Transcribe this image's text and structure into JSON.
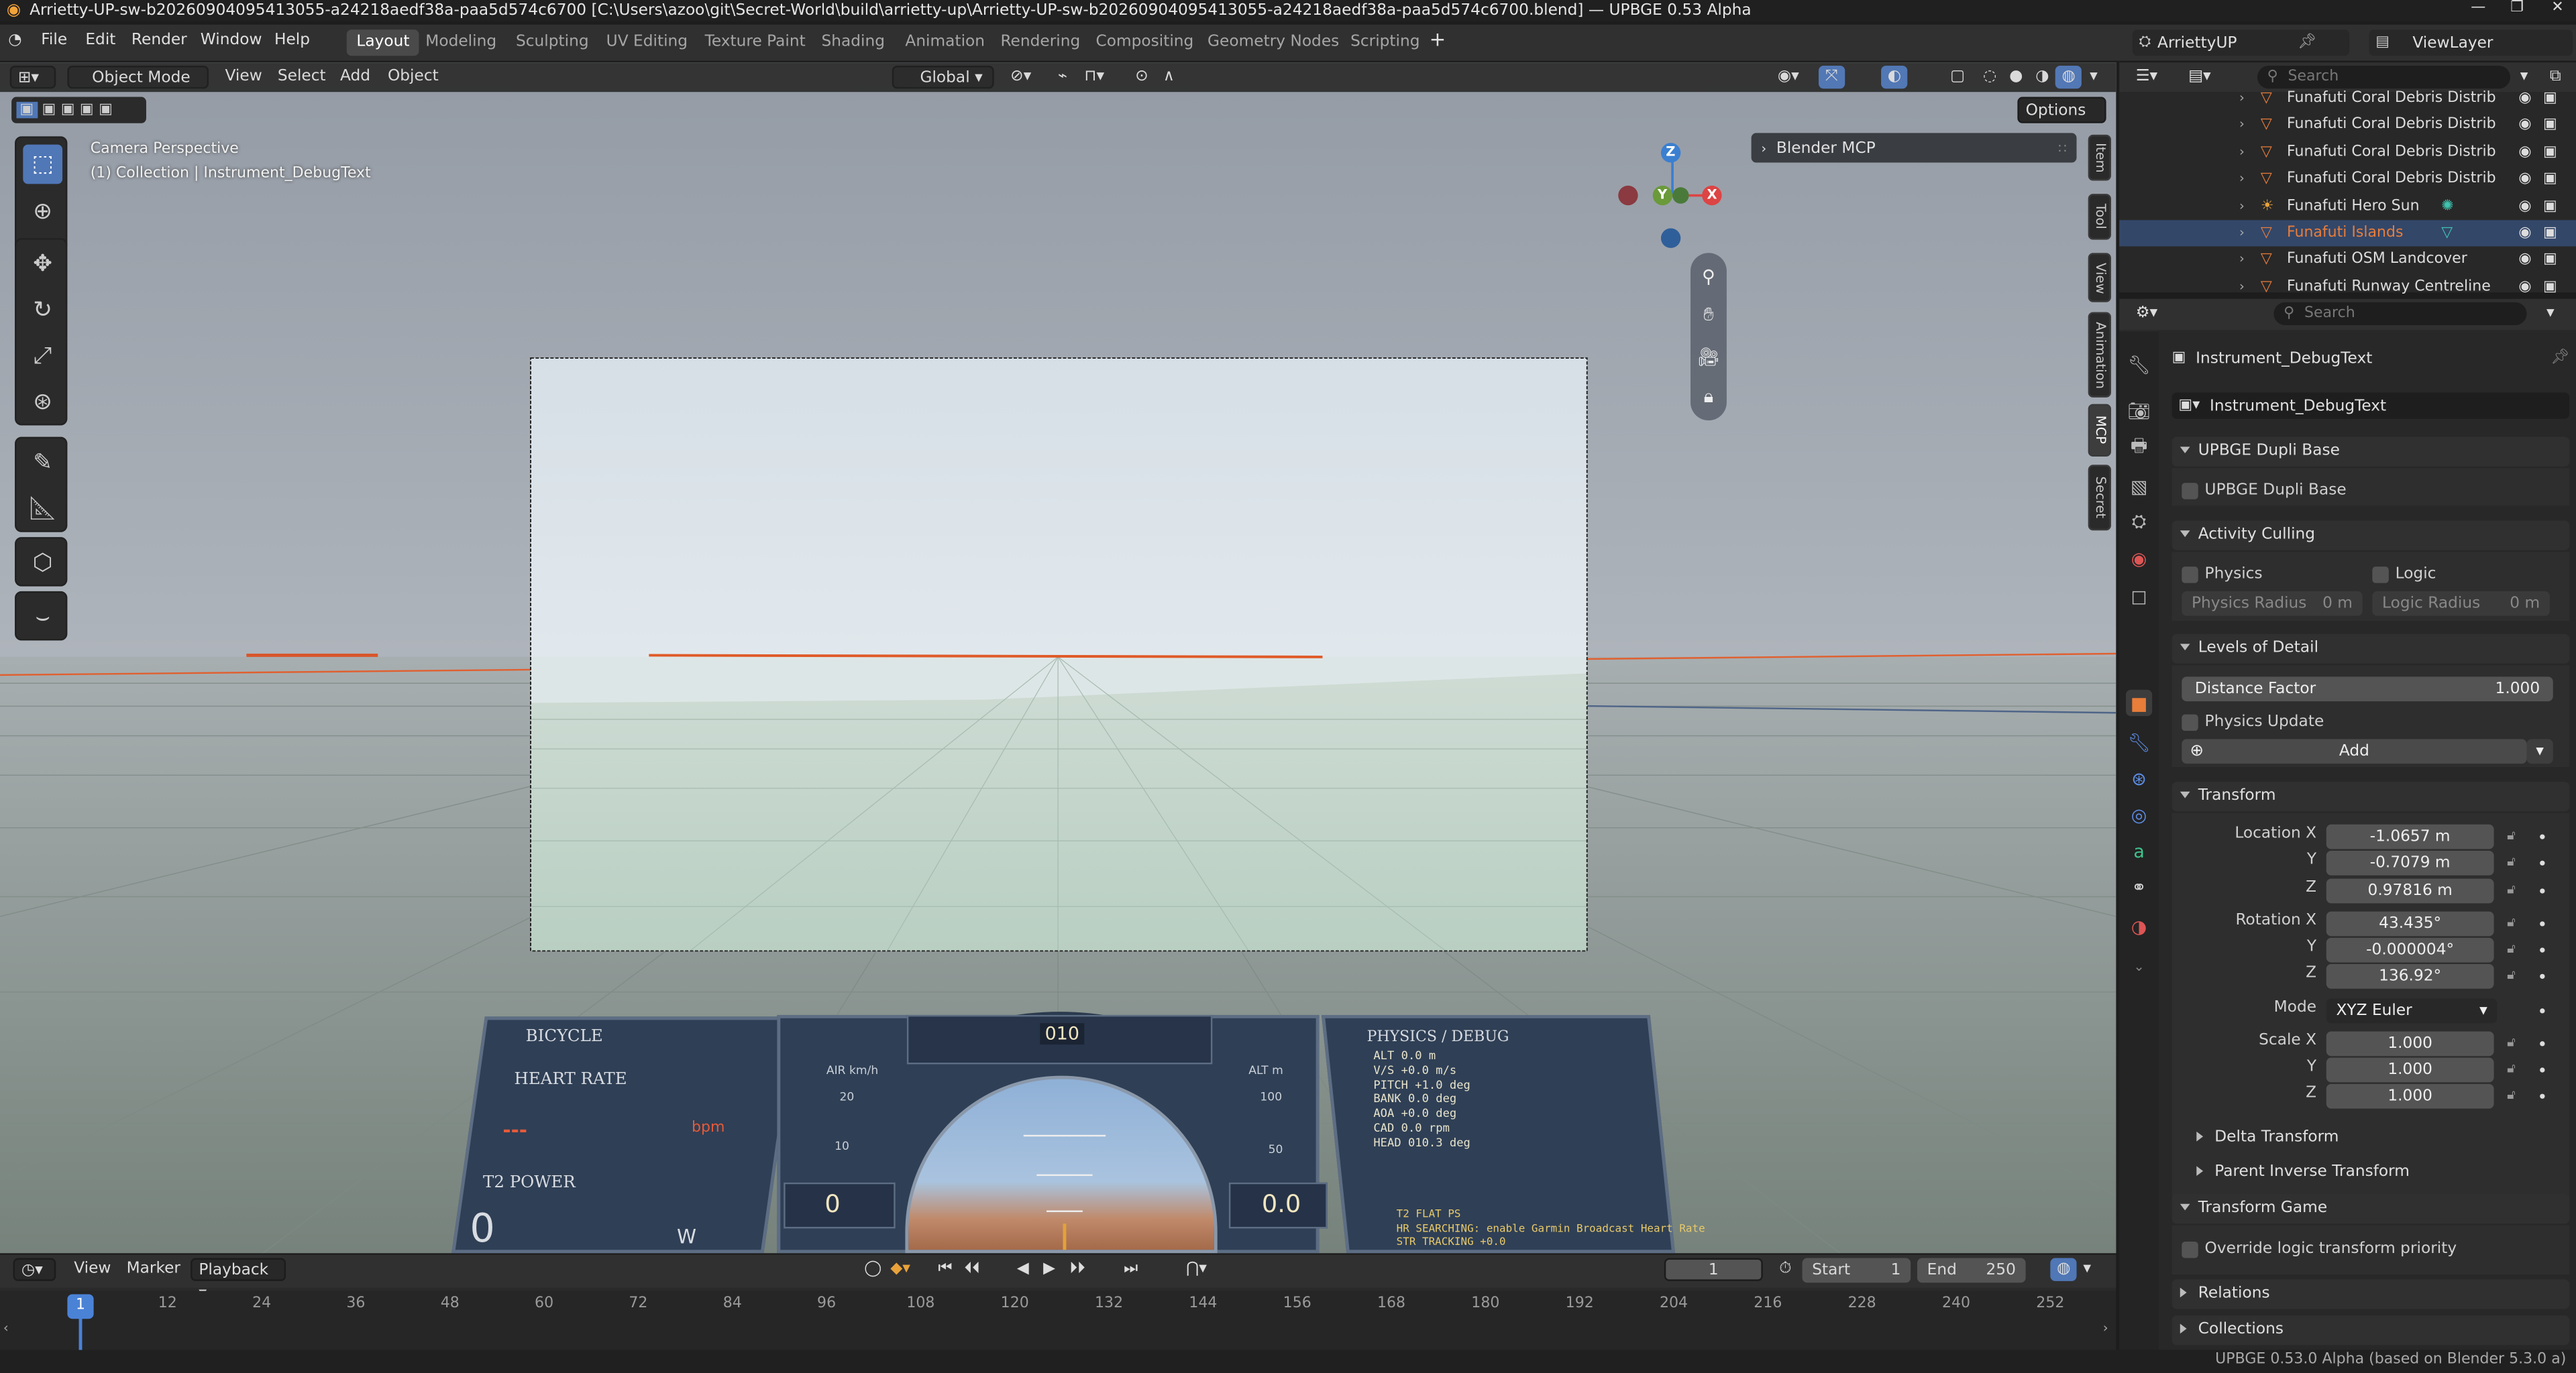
{
  "titlebar": {
    "title": "Arrietty-UP-sw-b20260904095413055-a24218aedf38a-paa5d574c6700 [C:\\Users\\azoo\\git\\Secret-World\\build\\arrietty-up\\Arrietty-UP-sw-b20260904095413055-a24218aedf38a-paa5d574c6700.blend] — UPBGE 0.53 Alpha"
  },
  "menu": {
    "file": "File",
    "edit": "Edit",
    "render": "Render",
    "window": "Window",
    "help": "Help"
  },
  "workspaces": [
    "Layout",
    "Modeling",
    "Sculpting",
    "UV Editing",
    "Texture Paint",
    "Shading",
    "Animation",
    "Rendering",
    "Compositing",
    "Geometry Nodes",
    "Scripting"
  ],
  "topright": {
    "scene": "ArriettyUP",
    "view_layer": "ViewLayer"
  },
  "viewport": {
    "mode": "Object Mode",
    "view": "View",
    "select": "Select",
    "add": "Add",
    "object": "Object",
    "orientation": "Global",
    "options": "Options",
    "overlay_title": "Camera Perspective",
    "overlay_subtitle": "(1) Collection | Instrument_DebugText",
    "mcp_panel": "Blender MCP",
    "ntabs": [
      "Item",
      "Tool",
      "View",
      "Animation",
      "MCP",
      "Secret"
    ],
    "gizmo": {
      "z": "Z",
      "y": "Y",
      "x": "X"
    },
    "hud": {
      "left_title": "BICYCLE",
      "heart": "HEART RATE",
      "heart_val": "---",
      "heart_unit": "bpm",
      "power": "T2 POWER",
      "power_val": "0",
      "power_unit": "W",
      "heading": "010",
      "air": "AIR km/h",
      "alt": "ALT m",
      "air_val": "0",
      "alt_val": "0.0",
      "scale_left": [
        "20",
        "10"
      ],
      "scale_right": [
        "100",
        "50"
      ],
      "debug_title": "PHYSICS / DEBUG",
      "debug_lines": [
        "ALT    0.0 m",
        "V/S   +0.0 m/s",
        "PITCH  +1.0 deg",
        "BANK   0.0 deg",
        "AOA   +0.0 deg",
        "CAD    0.0 rpm",
        "HEAD   010.3 deg"
      ],
      "debug_footer": [
        "T2  FLAT PS",
        "HR SEARCHING: enable Garmin Broadcast Heart Rate",
        "STR TRACKING +0.0"
      ]
    }
  },
  "timeline": {
    "view": "View",
    "marker": "Marker",
    "playback": "Playback",
    "current_frame": "1",
    "start_label": "Start",
    "start": "1",
    "end_label": "End",
    "end": "250",
    "ticks": [
      "1",
      "12",
      "24",
      "36",
      "48",
      "60",
      "72",
      "84",
      "96",
      "108",
      "120",
      "132",
      "144",
      "156",
      "168",
      "180",
      "192",
      "204",
      "216",
      "228",
      "240",
      "252"
    ]
  },
  "outliner": {
    "search_placeholder": "Search",
    "rows": [
      {
        "name": "Funafuti Coral Debris Distrib",
        "type": "mesh"
      },
      {
        "name": "Funafuti Coral Debris Distrib",
        "type": "mesh"
      },
      {
        "name": "Funafuti Coral Debris Distrib",
        "type": "mesh"
      },
      {
        "name": "Funafuti Coral Debris Distrib",
        "type": "mesh"
      },
      {
        "name": "Funafuti Hero Sun",
        "type": "light"
      },
      {
        "name": "Funafuti Islands",
        "type": "mesh",
        "selected": true
      },
      {
        "name": "Funafuti OSM Landcover",
        "type": "mesh"
      },
      {
        "name": "Funafuti Runway Centreline",
        "type": "mesh"
      }
    ]
  },
  "properties": {
    "search_placeholder": "Search",
    "object_name": "Instrument_DebugText",
    "datablock": "Instrument_DebugText",
    "upbge_dupli": {
      "header": "UPBGE Dupli Base",
      "checkbox": "UPBGE Dupli Base"
    },
    "culling": {
      "header": "Activity Culling",
      "physics": "Physics",
      "logic": "Logic",
      "physics_radius": "Physics Radius",
      "physics_radius_val": "0 m",
      "logic_radius": "Logic Radius",
      "logic_radius_val": "0 m"
    },
    "lod": {
      "header": "Levels of Detail",
      "distance_factor": "Distance Factor",
      "distance_factor_val": "1.000",
      "physics_update": "Physics Update",
      "add": "Add"
    },
    "transform": {
      "header": "Transform",
      "location_label": "Location X",
      "loc_x": "-1.0657 m",
      "loc_y": "-0.7079 m",
      "loc_z": "0.97816 m",
      "rotation_label": "Rotation X",
      "rot_x": "43.435°",
      "rot_y": "-0.000004°",
      "rot_z": "136.92°",
      "mode_label": "Mode",
      "mode": "XYZ Euler",
      "scale_label": "Scale X",
      "scale_x": "1.000",
      "scale_y": "1.000",
      "scale_z": "1.000",
      "y": "Y",
      "z": "Z",
      "delta": "Delta Transform",
      "parent_inverse": "Parent Inverse Transform"
    },
    "transform_game": {
      "header": "Transform Game",
      "override": "Override logic transform priority"
    },
    "relations": "Relations",
    "collections": "Collections"
  },
  "status": {
    "version": "UPBGE 0.53.0 Alpha (based on Blender 5.3.0 a)"
  },
  "colors": {
    "accent": "#5077b6",
    "selection": "#334769",
    "active_object": "#e97d3a",
    "panel": "#2e2e2e",
    "header": "#303030",
    "hud_panel": "#2f3f55"
  }
}
